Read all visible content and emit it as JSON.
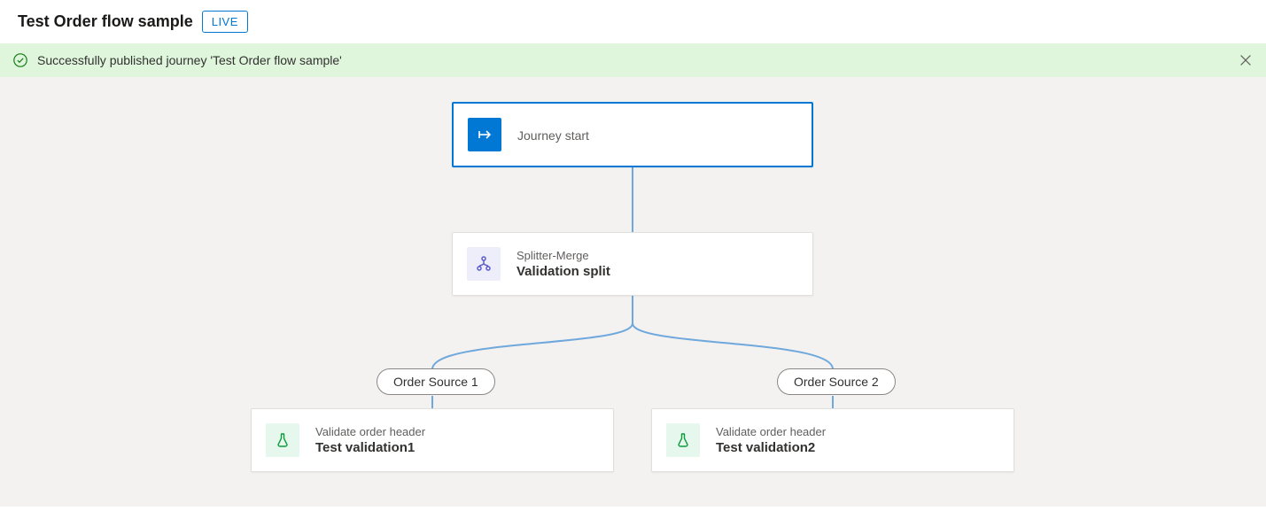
{
  "header": {
    "title": "Test Order flow sample",
    "badge": "LIVE"
  },
  "banner": {
    "message": "Successfully published journey 'Test Order flow sample'"
  },
  "nodes": {
    "start": {
      "title": "Journey start"
    },
    "split": {
      "type": "Splitter-Merge",
      "title": "Validation split"
    },
    "branch1": {
      "label": "Order Source 1"
    },
    "branch2": {
      "label": "Order Source 2"
    },
    "validate1": {
      "type": "Validate order header",
      "title": "Test validation1"
    },
    "validate2": {
      "type": "Validate order header",
      "title": "Test validation2"
    }
  }
}
